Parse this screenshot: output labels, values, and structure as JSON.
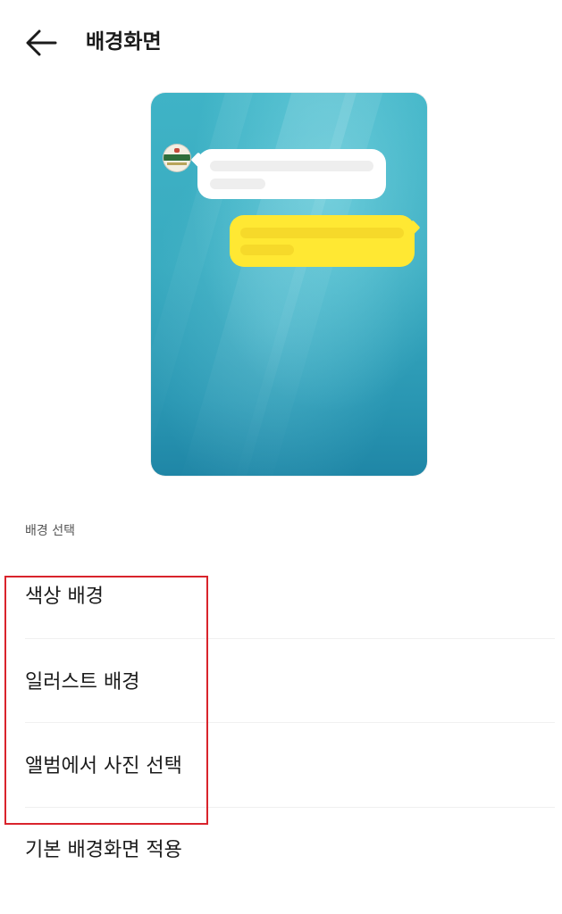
{
  "header": {
    "back_icon": "arrow-left-icon",
    "title": "배경화면"
  },
  "preview": {
    "background_color": "#3fb3c6",
    "incoming_bubble_color": "#ffffff",
    "outgoing_bubble_color": "#ffe833",
    "avatar_icon": "profile-avatar-icon"
  },
  "section": {
    "label": "배경 선택"
  },
  "menu": {
    "items": [
      {
        "label": "색상 배경"
      },
      {
        "label": "일러스트 배경"
      },
      {
        "label": "앨범에서 사진 선택"
      },
      {
        "label": "기본 배경화면 적용"
      }
    ]
  },
  "highlight": {
    "color": "#d9242c"
  }
}
